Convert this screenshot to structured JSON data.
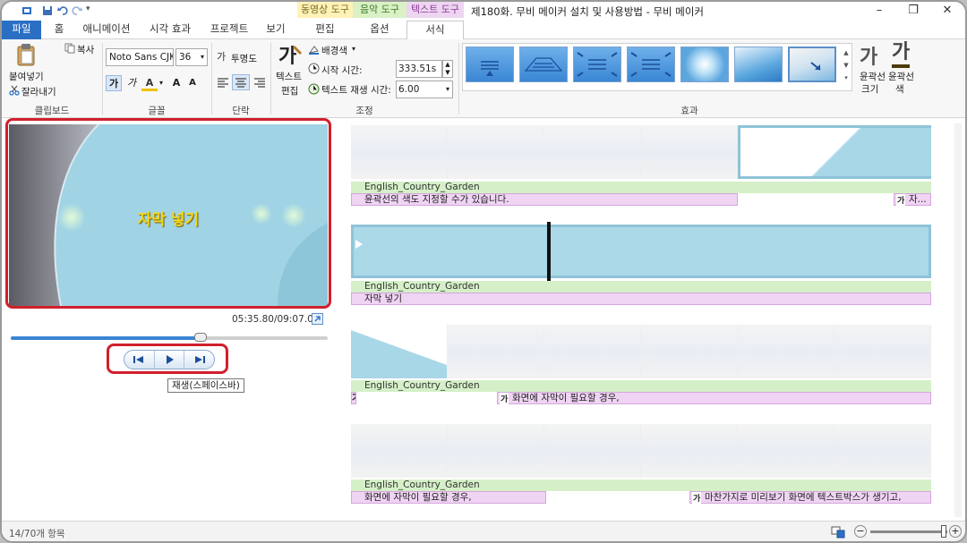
{
  "window": {
    "title": "제180화. 무비 메이커 설치 및 사용방법 - 무비 메이커",
    "minimize": "–",
    "maximize": "❐",
    "close": "✕"
  },
  "context_groups": [
    {
      "label": "동영상 도구"
    },
    {
      "label": "음악 도구"
    },
    {
      "label": "텍스트 도구"
    }
  ],
  "tabs": {
    "file": "파일",
    "home": "홈",
    "animations": "애니메이션",
    "visual_effects": "시각 효과",
    "project": "프로젝트",
    "view": "보기",
    "edit": "편집",
    "options": "옵션",
    "format": "서식"
  },
  "ribbon": {
    "clipboard": {
      "paste": "붙여넣기",
      "copy": "복사",
      "cut": "잘라내기",
      "label": "클립보드"
    },
    "font": {
      "name": "Noto Sans CJK",
      "size": "36",
      "label": "글꼴",
      "bold": "가",
      "italic": "가",
      "color": "A",
      "grow": "A",
      "shrink": "A"
    },
    "paragraph": {
      "transparency": "투명도",
      "label": "단락"
    },
    "adjust": {
      "text_edit": "텍스트\n편집",
      "text_edit_line1": "텍스트",
      "text_edit_line2": "편집",
      "background_color": "배경색",
      "start_time_label": "시작 시간:",
      "start_time_value": "333.51s",
      "duration_label": "텍스트 재생 시간:",
      "duration_value": "6.00",
      "label": "조정"
    },
    "effects": {
      "label": "효과",
      "outline_size_line1": "윤곽선",
      "outline_size_line2": "크기",
      "outline_color_line1": "윤곽선",
      "outline_color_line2": "색",
      "outline_size_glyph": "가",
      "outline_color_glyph": "가"
    }
  },
  "preview": {
    "caption": "자막 넣기",
    "time_readout": "05:35.80/09:07.00",
    "seek_progress": 0.6,
    "tooltip": "재생(스페이스바)"
  },
  "storyboard": {
    "music_label": "English_Country_Garden",
    "rows": [
      {
        "music": "English_Country_Garden",
        "captions": [
          {
            "text": "윤곽선의 색도 지정할 수가 있습니다."
          },
          {
            "text": "자..."
          }
        ]
      },
      {
        "music": "English_Country_Garden",
        "captions": [
          {
            "text": "자막 넣기"
          }
        ]
      },
      {
        "music": "English_Country_Garden",
        "captions": [
          {
            "text": "가"
          },
          {
            "text": "화면에 자막이 필요할 경우,"
          }
        ]
      },
      {
        "music": "English_Country_Garden",
        "captions": [
          {
            "text": "화면에 자막이 필요할 경우,"
          },
          {
            "text": "마찬가지로 미리보기 화면에 텍스트박스가 생기고,"
          }
        ]
      }
    ]
  },
  "status": {
    "items": "14/70개 항목",
    "zoom_out": "−",
    "zoom_in": "+",
    "zoom_level": 0.95
  },
  "colors": {
    "file_tab": "#2a6fc4",
    "highlight": "#d0202c",
    "music_bar": "#d5f0c8",
    "caption_bar": "#f0d4f4",
    "context_video": "#fff2b8",
    "context_music": "#d9f1c5",
    "context_text": "#eed5f1",
    "caption_text": "#f2d81b"
  },
  "icons": [
    "save-icon",
    "undo-icon",
    "redo-icon",
    "paste-icon",
    "copy-icon",
    "cut-icon",
    "text-edit-icon",
    "background-color-icon",
    "start-time-icon",
    "duration-icon",
    "previous-frame-icon",
    "play-icon",
    "next-frame-icon",
    "fullscreen-icon",
    "zoom-out-icon",
    "zoom-in-icon",
    "storyboard-view-icon"
  ]
}
